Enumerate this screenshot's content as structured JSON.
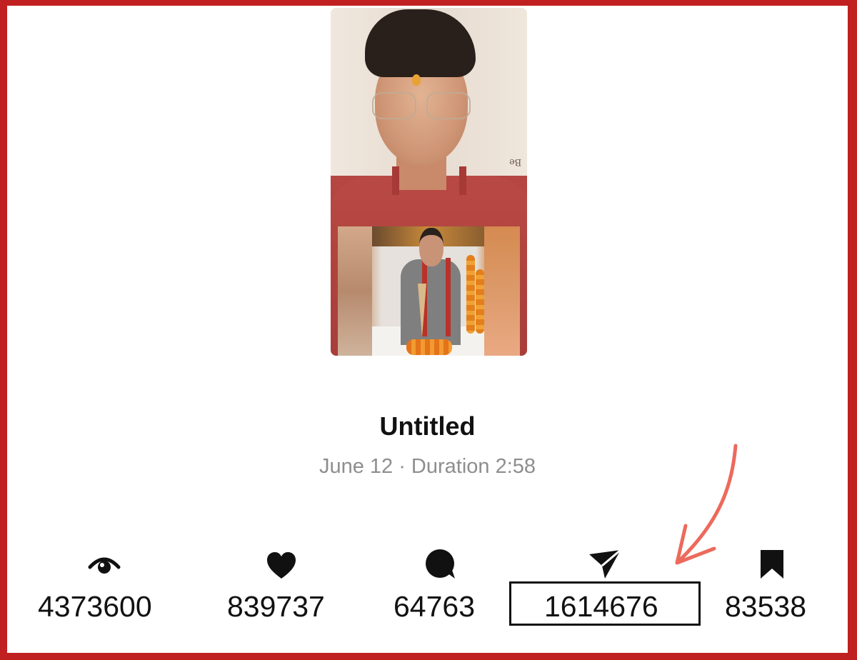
{
  "video": {
    "title": "Untitled",
    "meta": "June 12 · Duration 2:58",
    "background_sign_text": "Be"
  },
  "stats": [
    {
      "icon": "eye-icon",
      "value": "4373600"
    },
    {
      "icon": "heart-icon",
      "value": "839737"
    },
    {
      "icon": "comment-icon",
      "value": "64763"
    },
    {
      "icon": "share-icon",
      "value": "1614676"
    },
    {
      "icon": "bookmark-icon",
      "value": "83538"
    }
  ],
  "colors": {
    "border": "#c0201f",
    "text": "#111111",
    "muted": "#8e8e8e",
    "annotation_arrow": "#ec6a5c"
  }
}
